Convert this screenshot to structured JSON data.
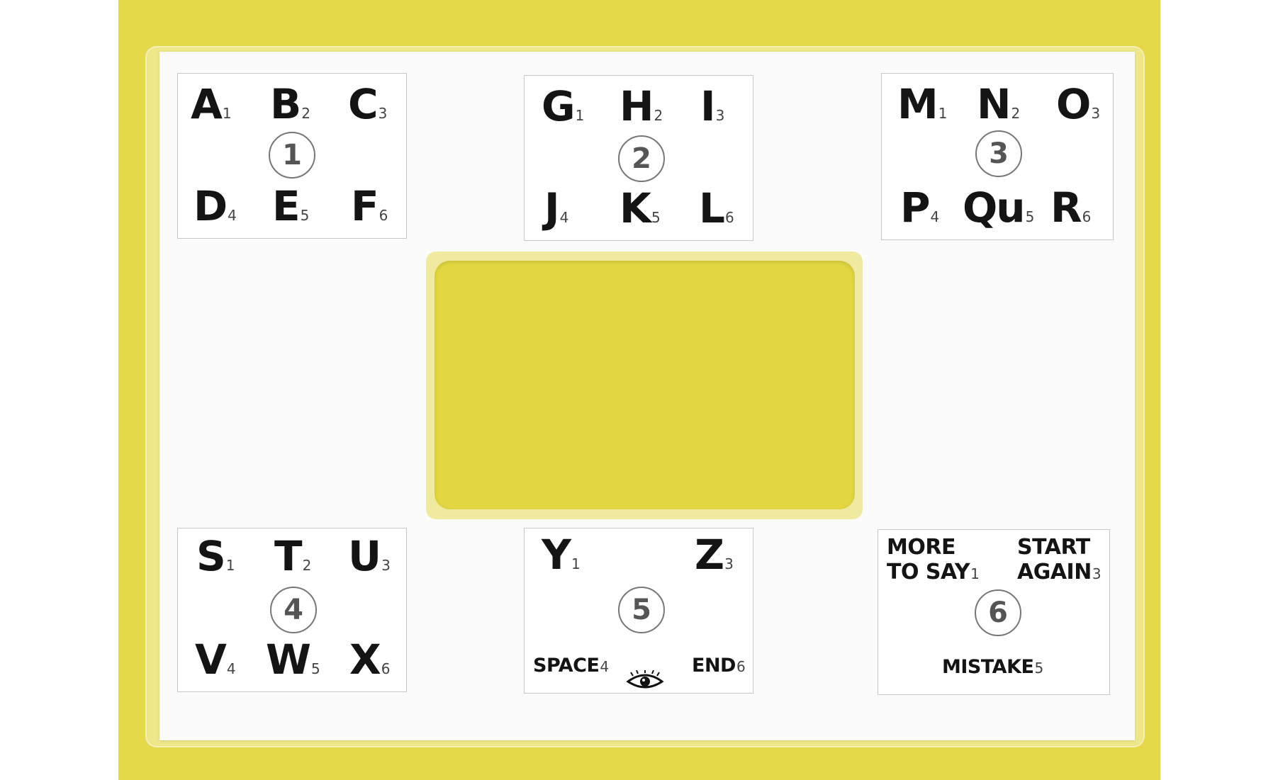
{
  "colors": {
    "card": "#e4d948",
    "sheet": "#fbfbfb",
    "text": "#141414",
    "circle": "#777777"
  },
  "groups": [
    {
      "number": "1",
      "cells": [
        {
          "t": "A",
          "n": "1"
        },
        {
          "t": "B",
          "n": "2"
        },
        {
          "t": "C",
          "n": "3"
        },
        {
          "t": "D",
          "n": "4"
        },
        {
          "t": "E",
          "n": "5"
        },
        {
          "t": "F",
          "n": "6"
        }
      ]
    },
    {
      "number": "2",
      "cells": [
        {
          "t": "G",
          "n": "1"
        },
        {
          "t": "H",
          "n": "2"
        },
        {
          "t": "I",
          "n": "3"
        },
        {
          "t": "J",
          "n": "4"
        },
        {
          "t": "K",
          "n": "5"
        },
        {
          "t": "L",
          "n": "6"
        }
      ]
    },
    {
      "number": "3",
      "cells": [
        {
          "t": "M",
          "n": "1"
        },
        {
          "t": "N",
          "n": "2"
        },
        {
          "t": "O",
          "n": "3"
        },
        {
          "t": "P",
          "n": "4"
        },
        {
          "t": "Qu",
          "n": "5"
        },
        {
          "t": "R",
          "n": "6"
        }
      ]
    },
    {
      "number": "4",
      "cells": [
        {
          "t": "S",
          "n": "1"
        },
        {
          "t": "T",
          "n": "2"
        },
        {
          "t": "U",
          "n": "3"
        },
        {
          "t": "V",
          "n": "4"
        },
        {
          "t": "W",
          "n": "5"
        },
        {
          "t": "X",
          "n": "6"
        }
      ]
    },
    {
      "number": "5",
      "cells": [
        {
          "t": "Y",
          "n": "1"
        },
        {
          "t": "Z",
          "n": "3"
        },
        {
          "t": "SPACE",
          "n": "4"
        },
        {
          "t": "END",
          "n": "6"
        }
      ],
      "icon": "eye-icon"
    },
    {
      "number": "6",
      "cells": [
        {
          "t": "MORE",
          "t2": "TO SAY",
          "n": "1"
        },
        {
          "t": "START",
          "t2": "AGAIN",
          "n": "3"
        },
        {
          "t": "MISTAKE",
          "n": "5"
        }
      ]
    }
  ]
}
